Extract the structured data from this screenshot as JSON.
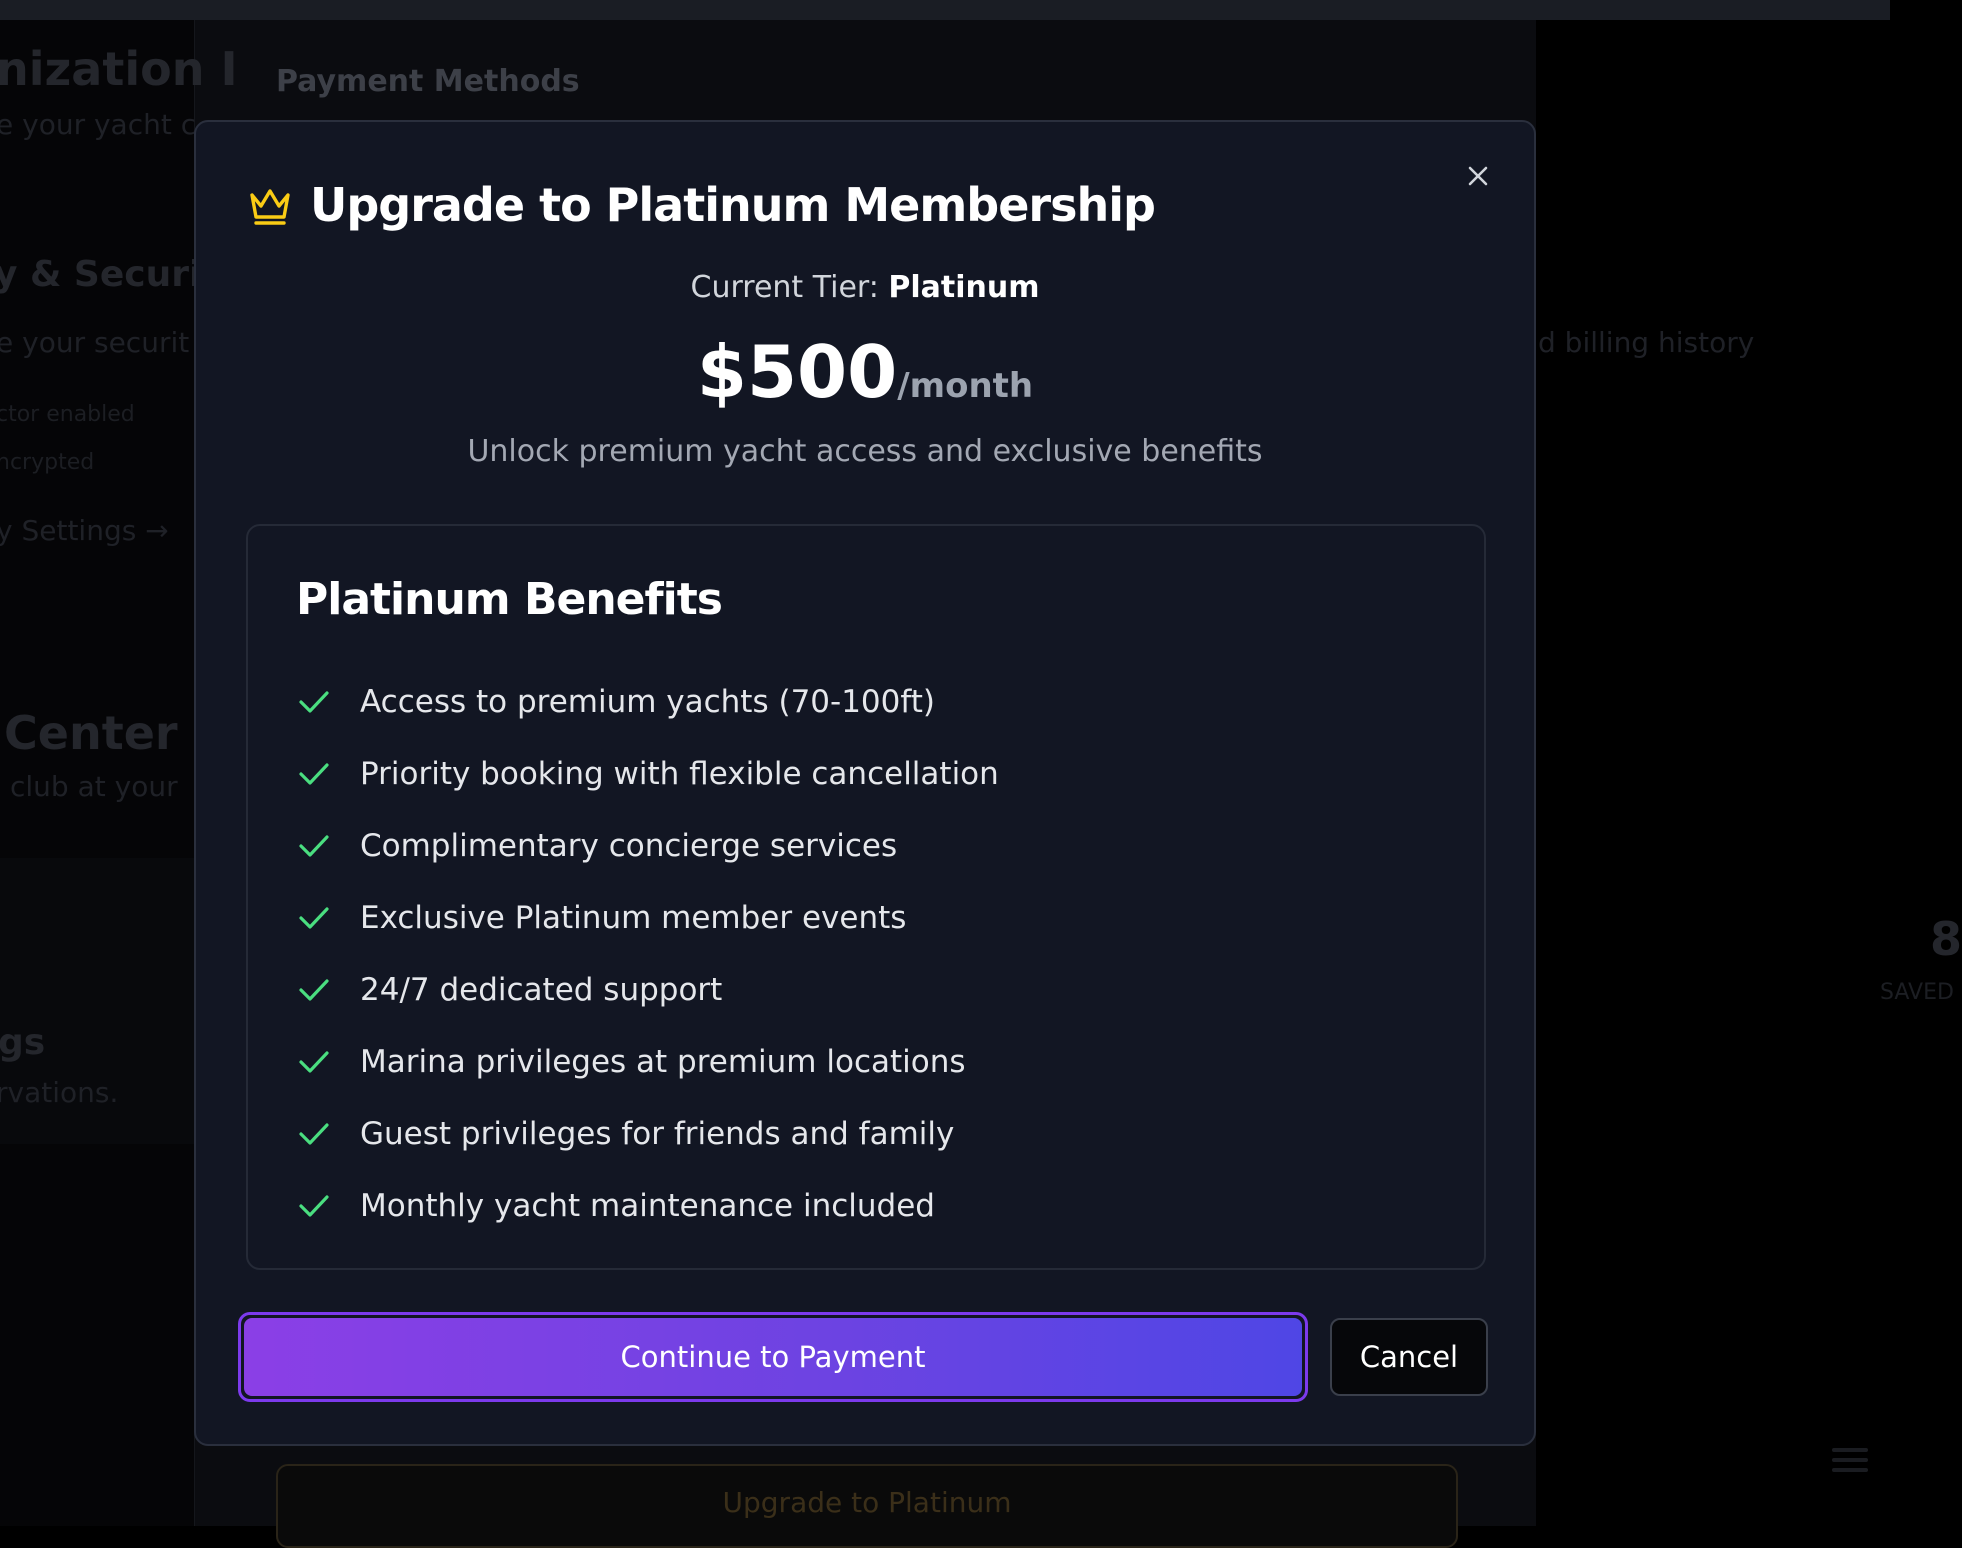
{
  "background": {
    "section_title": "Payment Methods",
    "left_fragments": [
      "nization I",
      "e your yacht c",
      "y & Securit",
      "e your securit",
      "ctor enabled",
      "ncrypted",
      "y Settings →",
      "Center",
      "club at your",
      "gs",
      "rvations."
    ],
    "right_fragments": [
      "d billing history",
      "8",
      "SAVED"
    ],
    "upgrade_button_label": "Upgrade to Platinum"
  },
  "modal": {
    "title": "Upgrade to Platinum Membership",
    "title_icon": "crown-icon",
    "close_icon": "close-icon",
    "current_tier_label": "Current Tier:",
    "current_tier_value": "Platinum",
    "price": "$500",
    "price_period": "/month",
    "subtitle": "Unlock premium yacht access and exclusive benefits",
    "benefits_title": "Platinum Benefits",
    "benefits": [
      "Access to premium yachts (70-100ft)",
      "Priority booking with flexible cancellation",
      "Complimentary concierge services",
      "Exclusive Platinum member events",
      "24/7 dedicated support",
      "Marina privileges at premium locations",
      "Guest privileges for friends and family",
      "Monthly yacht maintenance included"
    ],
    "continue_label": "Continue to Payment",
    "cancel_label": "Cancel"
  },
  "colors": {
    "modal_bg": "#121623",
    "accent_purple": "#8b3fe6",
    "accent_indigo": "#4f46e5",
    "check_green": "#4ade80",
    "crown_yellow": "#facc15"
  }
}
